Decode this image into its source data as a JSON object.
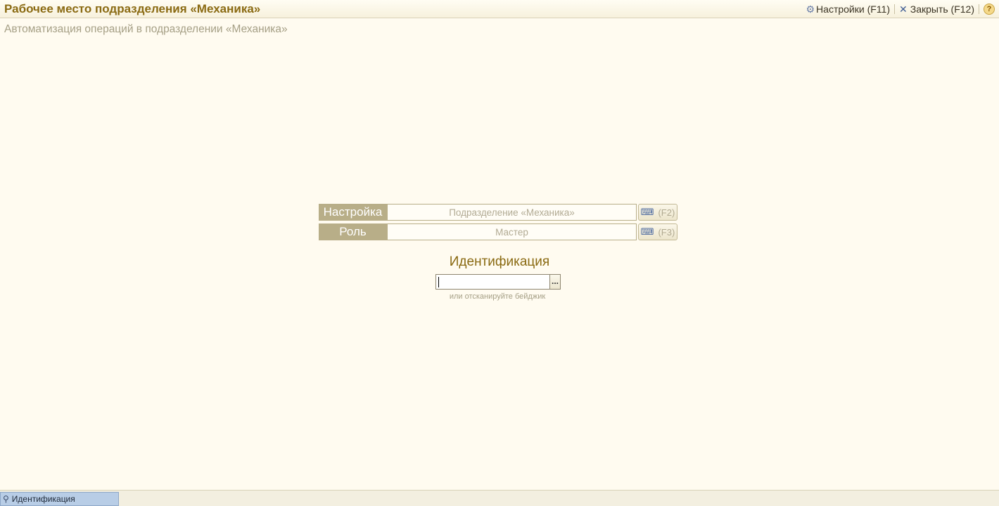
{
  "window": {
    "title": "Рабочее место подразделения «Механика»",
    "subtitle": "Автоматизация операций в подразделении «Механика»"
  },
  "toolbar": {
    "settings_label": "Настройки (F11)",
    "close_label": "Закрыть (F12)",
    "help_glyph": "?"
  },
  "form": {
    "setting": {
      "label": "Настройка",
      "value": "Подразделение «Механика»",
      "hotkey": "(F2)"
    },
    "role": {
      "label": "Роль",
      "value": "Мастер",
      "hotkey": "(F3)"
    },
    "identification": {
      "title": "Идентификация",
      "value": "",
      "choose_button": "...",
      "hint": "или отсканируйте бейджик"
    }
  },
  "statusbar": {
    "active_tab": "Идентификация"
  },
  "icons": {
    "settings": "gear-icon",
    "close": "close-icon",
    "help": "help-icon",
    "select_setting": "keyboard-select-icon",
    "pin": "pin-icon"
  },
  "colors": {
    "accent_text": "#8a6a12",
    "label_bg": "#b8ae88",
    "background": "#fffbf0",
    "status_tab": "#b8cde6"
  }
}
